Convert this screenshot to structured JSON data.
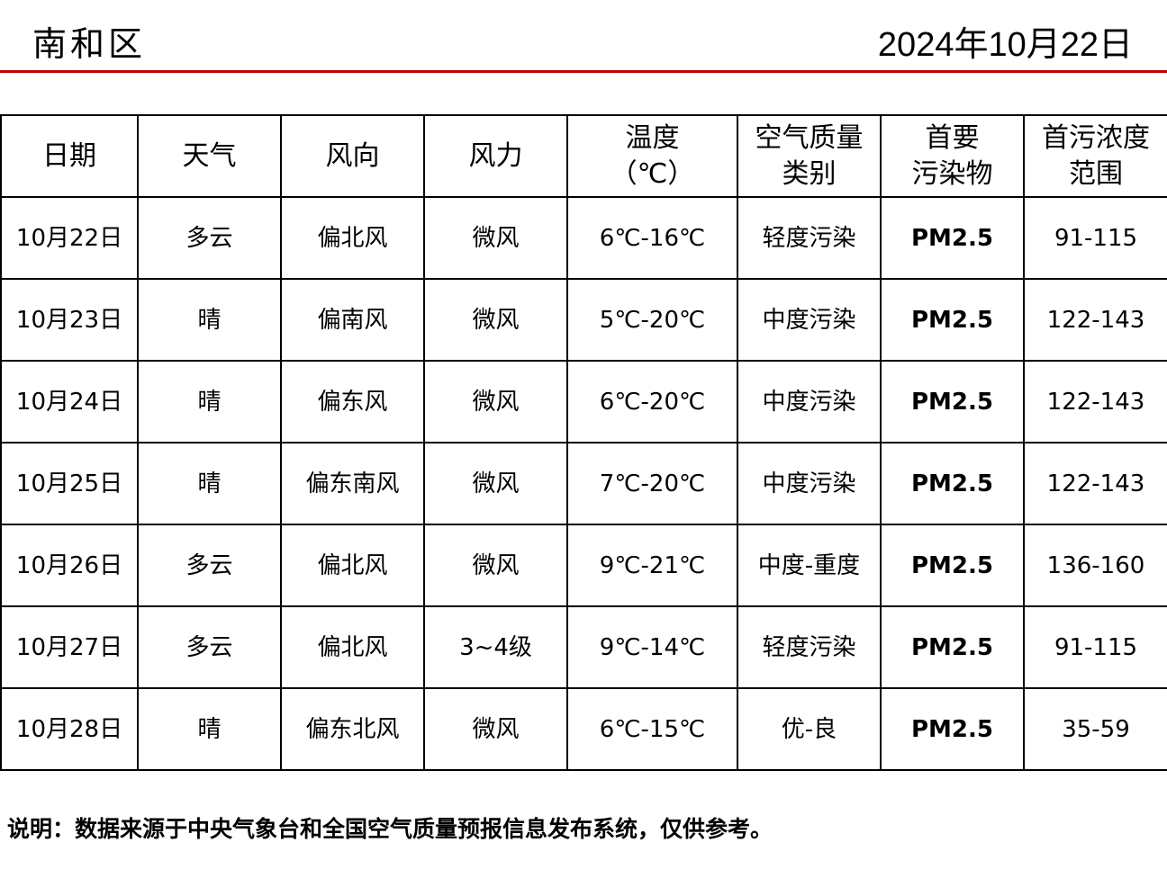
{
  "header": {
    "title": "南和区",
    "date": "2024年10月22日"
  },
  "table": {
    "headers": [
      "日期",
      "天气",
      "风向",
      "风力",
      "温度\n（℃）",
      "空气质量\n类别",
      "首要\n污染物",
      "首污浓度\n范围"
    ],
    "rows": [
      [
        "10月22日",
        "多云",
        "偏北风",
        "微风",
        "6℃-16℃",
        "轻度污染",
        "PM2.5",
        "91-115"
      ],
      [
        "10月23日",
        "晴",
        "偏南风",
        "微风",
        "5℃-20℃",
        "中度污染",
        "PM2.5",
        "122-143"
      ],
      [
        "10月24日",
        "晴",
        "偏东风",
        "微风",
        "6℃-20℃",
        "中度污染",
        "PM2.5",
        "122-143"
      ],
      [
        "10月25日",
        "晴",
        "偏东南风",
        "微风",
        "7℃-20℃",
        "中度污染",
        "PM2.5",
        "122-143"
      ],
      [
        "10月26日",
        "多云",
        "偏北风",
        "微风",
        "9℃-21℃",
        "中度-重度",
        "PM2.5",
        "136-160"
      ],
      [
        "10月27日",
        "多云",
        "偏北风",
        "3~4级",
        "9℃-14℃",
        "轻度污染",
        "PM2.5",
        "91-115"
      ],
      [
        "10月28日",
        "晴",
        "偏东北风",
        "微风",
        "6℃-15℃",
        "优-良",
        "PM2.5",
        "35-59"
      ]
    ]
  },
  "note": "说明：数据来源于中央气象台和全国空气质量预报信息发布系统，仅供参考。",
  "colors": {
    "rule": "#c00000"
  }
}
